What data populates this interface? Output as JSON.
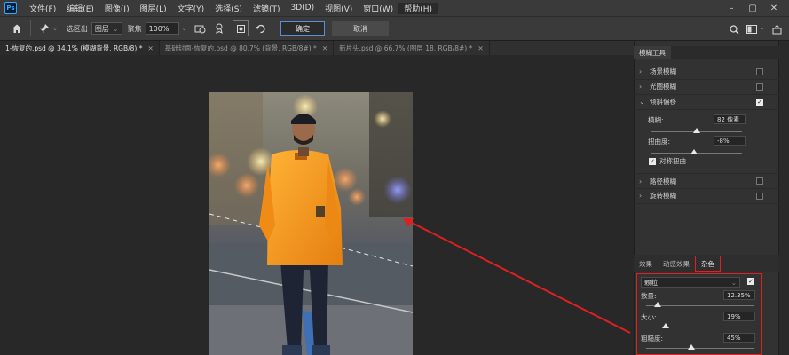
{
  "app_logo_text": "Ps",
  "menu": [
    "文件(F)",
    "编辑(E)",
    "图像(I)",
    "图层(L)",
    "文字(Y)",
    "选择(S)",
    "滤镜(T)",
    "3D(D)",
    "视图(V)",
    "窗口(W)",
    "帮助(H)"
  ],
  "options": {
    "select_label": "选区出",
    "select_value": "图层",
    "feather_label": "聚焦",
    "feather_value": "100%",
    "ok_label": "确定",
    "cancel_label": "取消"
  },
  "tabs": [
    {
      "label": "1-恢复的.psd @ 34.1% (模糊背景, RGB/8) *",
      "active": true
    },
    {
      "label": "基础封面-恢复的.psd @ 80.7% (背景, RGB/8#) *",
      "active": false
    },
    {
      "label": "新片头.psd @ 66.7% (图层 18, RGB/8#) *",
      "active": false
    }
  ],
  "blur_panel": {
    "title": "模糊工具",
    "items": [
      {
        "label": "场景模糊",
        "checked": false,
        "expanded": false
      },
      {
        "label": "光圈模糊",
        "checked": false,
        "expanded": false
      },
      {
        "label": "倾斜偏移",
        "checked": true,
        "expanded": true
      },
      {
        "label": "路径模糊",
        "checked": false,
        "expanded": false
      },
      {
        "label": "旋转模糊",
        "checked": false,
        "expanded": false
      }
    ],
    "tilt": {
      "blur_label": "模糊:",
      "blur_value": "82 像素",
      "blur_level": 0.65,
      "distortion_label": "扭曲度:",
      "distortion_value": "-8%",
      "distortion_level": 0.46,
      "symmetric_label": "对称扭曲",
      "symmetric_checked": true
    }
  },
  "effects_tabs": [
    {
      "label": "效果",
      "active": false
    },
    {
      "label": "动感效果",
      "active": false
    },
    {
      "label": "杂色",
      "active": true
    }
  ],
  "noise": {
    "type_value": "颗粒",
    "enabled": true,
    "amount_label": "数量:",
    "amount_value": "12.35%",
    "amount_level": 0.12,
    "size_label": "大小:",
    "size_value": "19%",
    "size_level": 0.19,
    "roughness_label": "粗糙度:",
    "roughness_value": "45%",
    "roughness_level": 0.45
  },
  "colors": {
    "annotation_red": "#e02020",
    "jacket_orange": "#f39a1e",
    "ok_border": "#5a8fd8"
  }
}
